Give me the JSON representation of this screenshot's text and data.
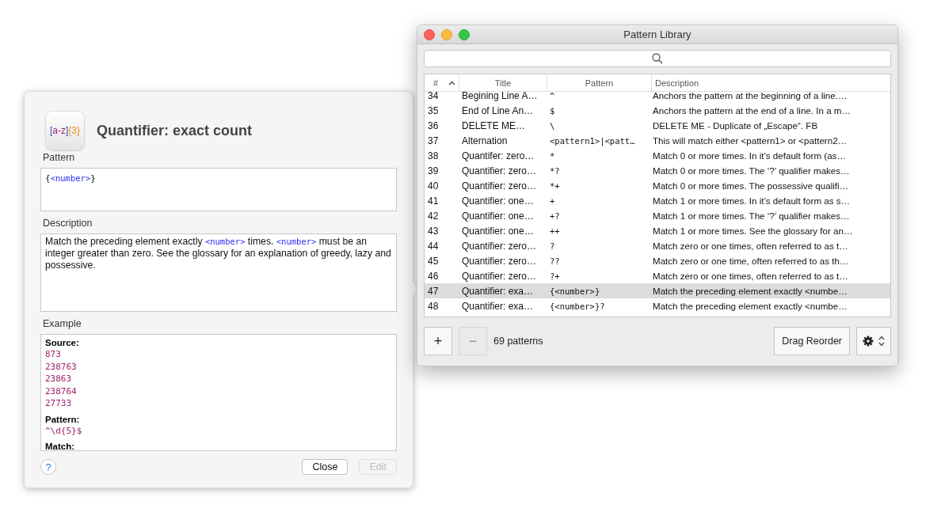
{
  "detail": {
    "icon_label": [
      {
        "kind": "bracket",
        "text": "["
      },
      {
        "kind": "range",
        "text": "a-z"
      },
      {
        "kind": "bracket",
        "text": "]"
      },
      {
        "kind": "quantifier",
        "text": "{3}"
      }
    ],
    "title": "Quantifier: exact count",
    "pattern_label": "Pattern",
    "pattern": [
      {
        "kind": "plain",
        "text": "{"
      },
      {
        "kind": "token",
        "text": "<number>"
      },
      {
        "kind": "plain",
        "text": "}"
      }
    ],
    "description_label": "Description",
    "description": [
      {
        "kind": "plain",
        "text": "Match the preceding element exactly "
      },
      {
        "kind": "token",
        "text": "<number>"
      },
      {
        "kind": "plain",
        "text": " times. "
      },
      {
        "kind": "token",
        "text": "<number>"
      },
      {
        "kind": "plain",
        "text": " must be an integer greater than zero. See the glossary for an explanation of greedy, lazy and possessive."
      }
    ],
    "example_label": "Example",
    "example": [
      {
        "kind": "heading",
        "text": "Source:"
      },
      {
        "kind": "code",
        "text": "873"
      },
      {
        "kind": "code",
        "text": "238763"
      },
      {
        "kind": "code",
        "text": "23863"
      },
      {
        "kind": "code",
        "text": "238764"
      },
      {
        "kind": "code",
        "text": "27733"
      },
      {
        "kind": "heading",
        "text": "Pattern:"
      },
      {
        "kind": "code",
        "text": "^\\d{5}$"
      },
      {
        "kind": "heading",
        "text": "Match:"
      }
    ],
    "help_button": "?",
    "buttons": [
      {
        "label": "Close",
        "disabled": false
      },
      {
        "label": "Edit",
        "disabled": true
      }
    ]
  },
  "library": {
    "title": "Pattern Library",
    "columns": [
      {
        "label": "#",
        "sorted": true
      },
      {
        "label": "Title",
        "sorted": false
      },
      {
        "label": "Pattern",
        "sorted": false
      },
      {
        "label": "Description",
        "sorted": false
      }
    ],
    "rows": [
      {
        "number": "34",
        "title": "Begining Line A…",
        "pattern": "^",
        "description": "Anchors the pattern at the beginning of a line.…",
        "selected": false
      },
      {
        "number": "35",
        "title": "End of Line An…",
        "pattern": "$",
        "description": "Anchors the pattern at the end of a line. In a m…",
        "selected": false
      },
      {
        "number": "36",
        "title": "DELETE ME…",
        "pattern": "\\",
        "description": "DELETE ME - Duplicate of „Escape“. FB",
        "selected": false
      },
      {
        "number": "37",
        "title": "Alternation",
        "pattern": "<pattern1>|<patt…",
        "description": "This will match either <pattern1> or <pattern2…",
        "selected": false
      },
      {
        "number": "38",
        "title": "Quantifer: zero…",
        "pattern": "*",
        "description": "Match 0 or more times. In it’s default form (as…",
        "selected": false
      },
      {
        "number": "39",
        "title": "Quantifier: zero…",
        "pattern": "*?",
        "description": "Match 0 or more times. The ‘?’ qualifier makes…",
        "selected": false
      },
      {
        "number": "40",
        "title": "Quantifier: zero…",
        "pattern": "*+",
        "description": "Match 0 or more times. The possessive qualifi…",
        "selected": false
      },
      {
        "number": "41",
        "title": "Quantifier: one…",
        "pattern": "+",
        "description": "Match 1 or more times. In it’s default form as s…",
        "selected": false
      },
      {
        "number": "42",
        "title": "Quantifier: one…",
        "pattern": "+?",
        "description": "Match 1 or more times. The ‘?’ qualifier makes…",
        "selected": false
      },
      {
        "number": "43",
        "title": "Quantifier: one…",
        "pattern": "++",
        "description": "Match 1 or more times. See the glossary for an…",
        "selected": false
      },
      {
        "number": "44",
        "title": "Quantifier: zero…",
        "pattern": "?",
        "description": "Match zero or one times, often referred to as t…",
        "selected": false
      },
      {
        "number": "45",
        "title": "Quantifier: zero…",
        "pattern": "??",
        "description": "Match zero or one time, often referred to as th…",
        "selected": false
      },
      {
        "number": "46",
        "title": "Quantifier: zero…",
        "pattern": "?+",
        "description": "Match zero or one times, often referred to as t…",
        "selected": false
      },
      {
        "number": "47",
        "title": "Quantifier: exa…",
        "pattern": "{<number>}",
        "description": "Match the preceding element exactly <numbe…",
        "selected": true
      },
      {
        "number": "48",
        "title": "Quantifier: exa…",
        "pattern": "{<number>}?",
        "description": "Match the preceding element exactly <numbe…",
        "selected": false
      }
    ],
    "add_button": {
      "label": "+",
      "disabled": false
    },
    "remove_button": {
      "label": "−",
      "disabled": true
    },
    "count": "69 patterns",
    "reorder_button": "Drag Reorder"
  }
}
